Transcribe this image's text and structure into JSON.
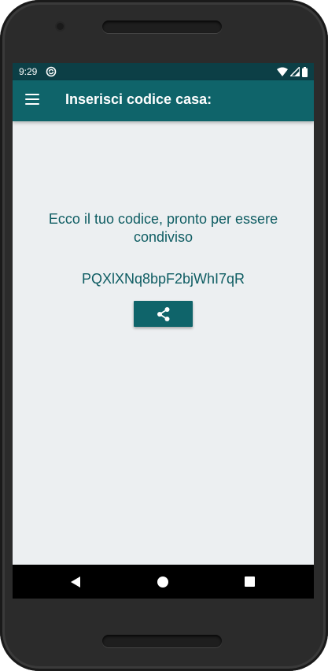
{
  "status_bar": {
    "time": "9:29",
    "icons": [
      "sync-icon",
      "wifi-icon",
      "signal-icon",
      "battery-icon"
    ]
  },
  "app_bar": {
    "menu_icon": "hamburger-menu-icon",
    "title": "Inserisci codice casa:"
  },
  "main": {
    "message": "Ecco il tuo codice, pronto per essere condiviso",
    "code": "PQXlXNq8bpF2bjWhI7qR",
    "share_icon": "share-icon"
  },
  "nav_bar": {
    "icons": [
      "back-icon",
      "home-icon",
      "recents-icon"
    ]
  },
  "colors": {
    "status_bar": "#0c3f46",
    "primary": "#0f646a",
    "text_primary": "#0f5d63",
    "background": "#eceff1"
  }
}
